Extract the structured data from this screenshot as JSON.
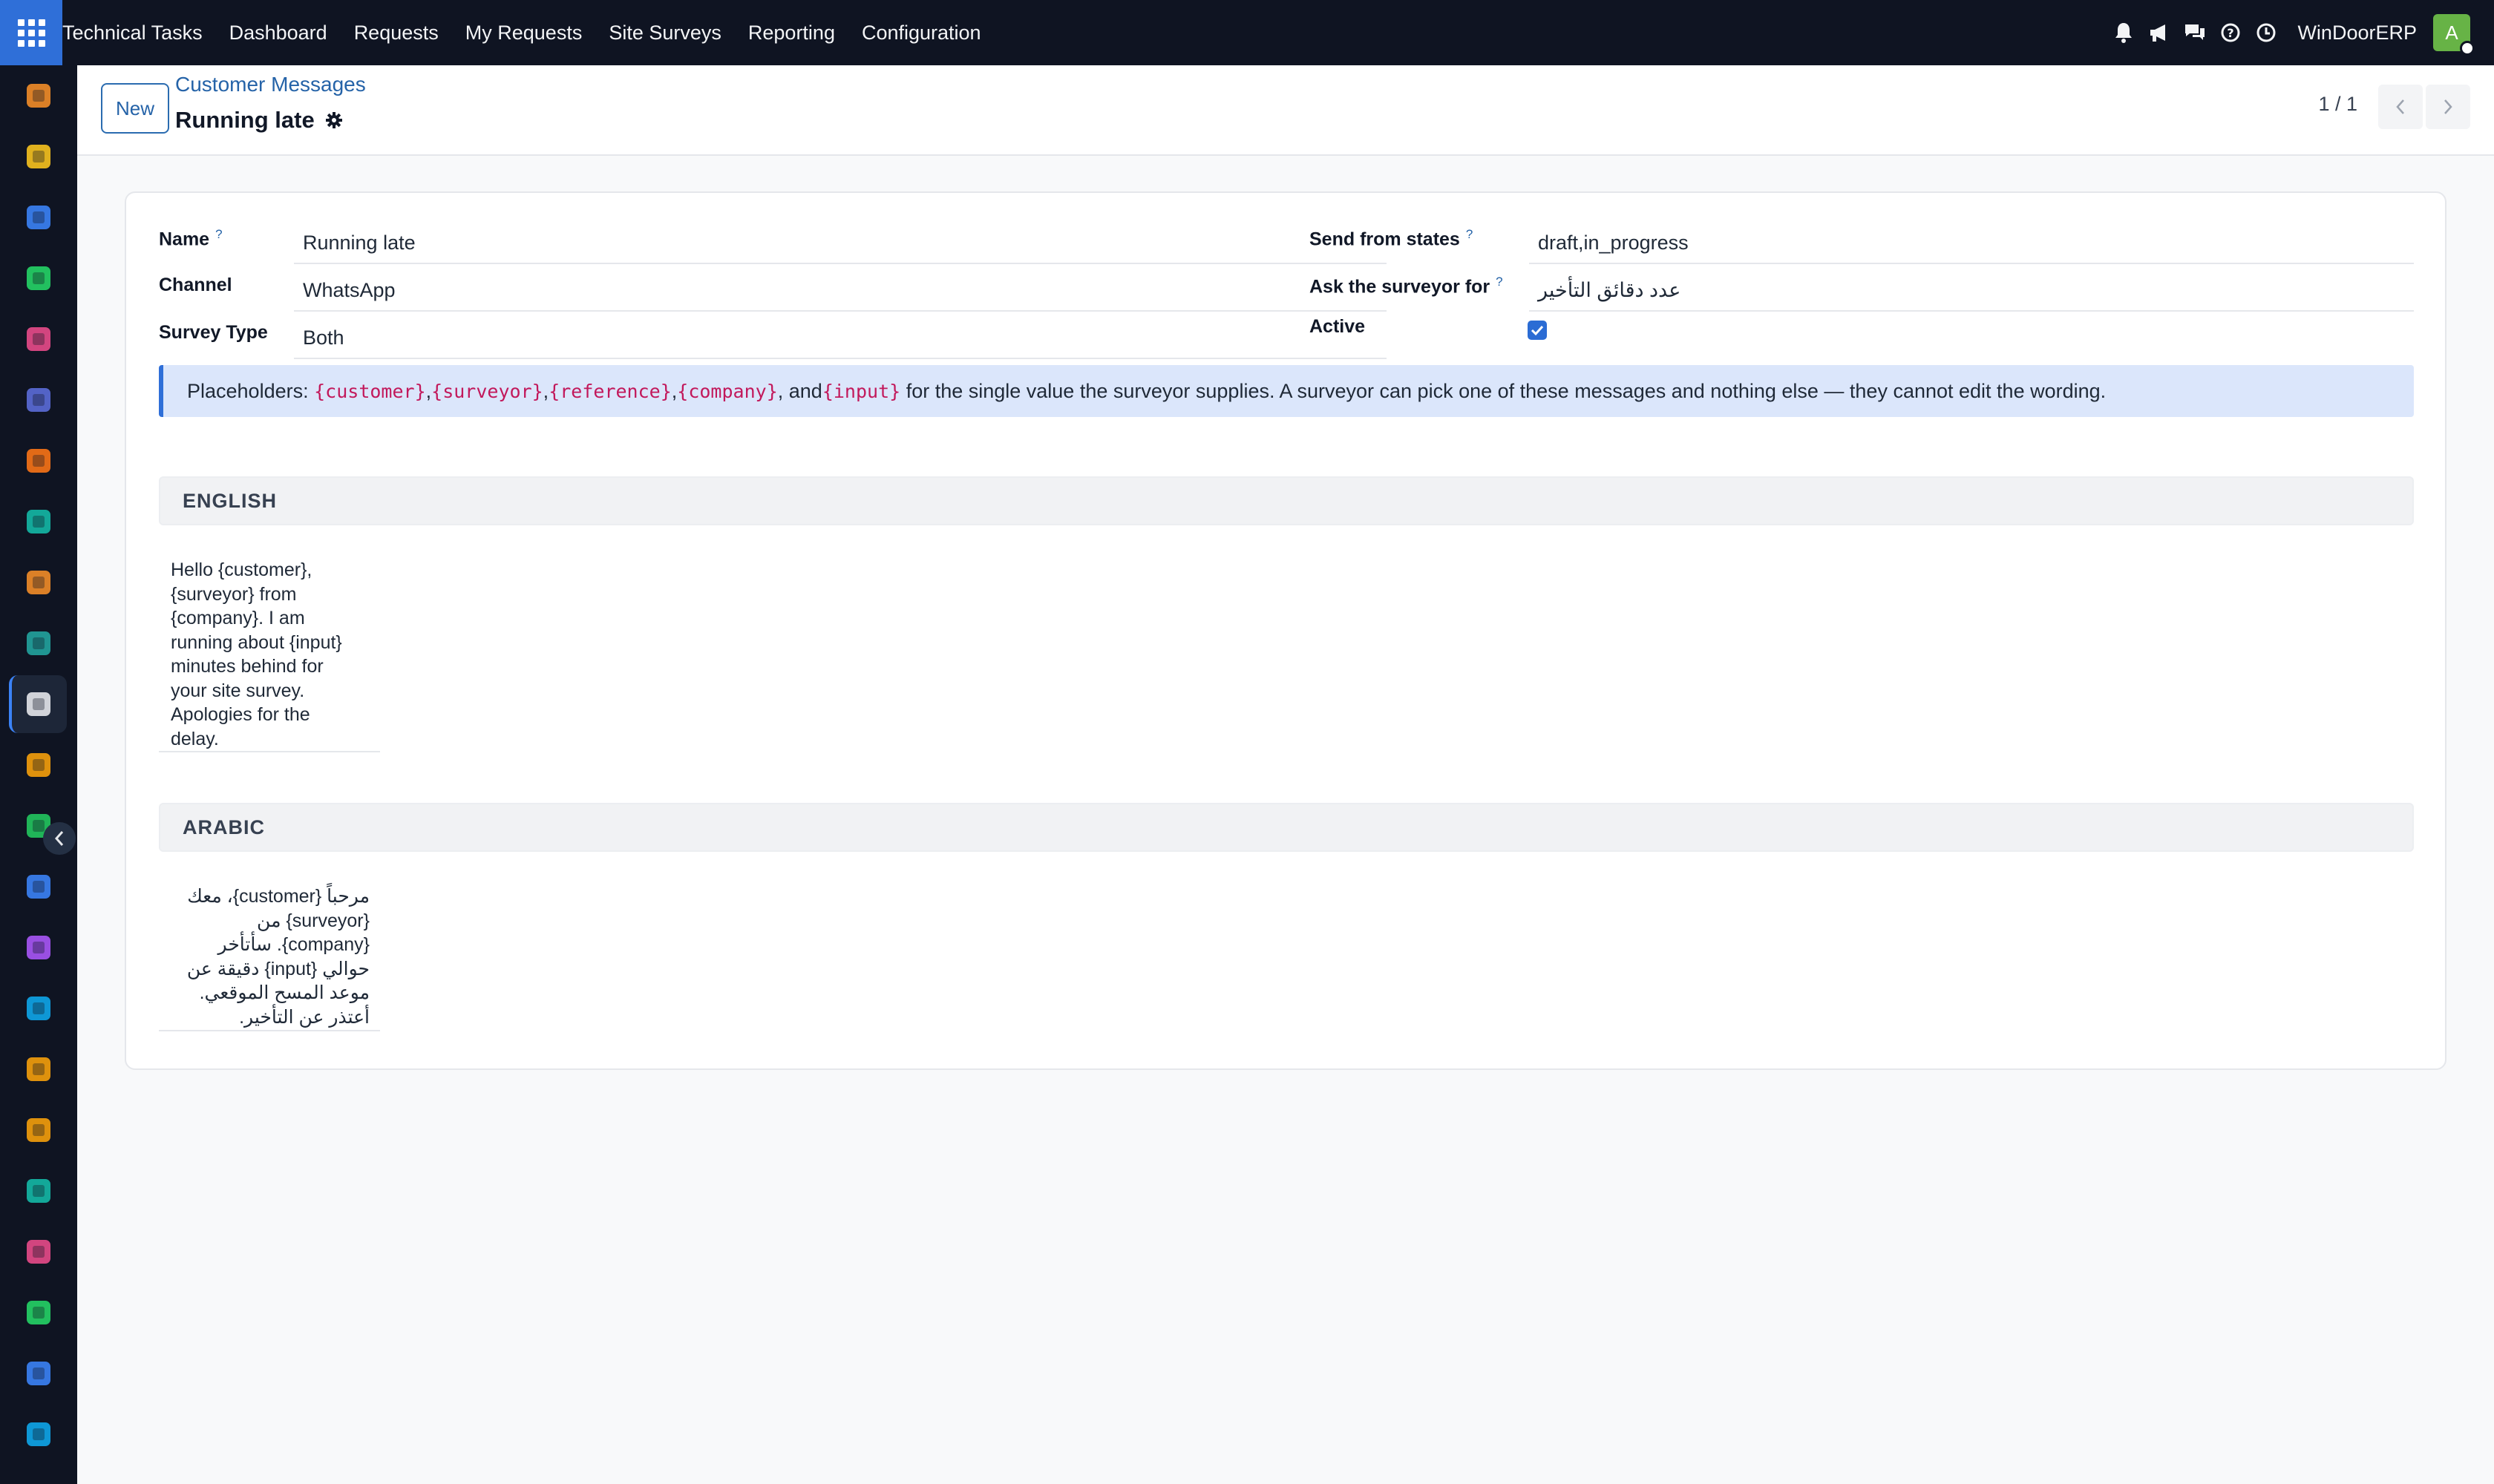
{
  "navbar": {
    "app_name": "Technical Tasks",
    "menu": [
      "Dashboard",
      "Requests",
      "My Requests",
      "Site Surveys",
      "Reporting",
      "Configuration"
    ],
    "right_icons": [
      "bell-icon",
      "megaphone-icon",
      "chat-icon",
      "help-icon",
      "clock-icon"
    ],
    "company": "WinDoorERP",
    "avatar_initial": "A",
    "avatar_color": "#67b346"
  },
  "sidebar": {
    "apps": [
      {
        "icon": "sales-app-icon",
        "color": "#f28c28"
      },
      {
        "icon": "paper-plane-icon",
        "color": "#f7c21e"
      },
      {
        "icon": "clock-app-icon",
        "color": "#3b82f6"
      },
      {
        "icon": "whatsapp-icon",
        "color": "#25d366"
      },
      {
        "icon": "dashboard-app-icon",
        "color": "#e84a8a"
      },
      {
        "icon": "mail-app-icon",
        "color": "#5b6bd8"
      },
      {
        "icon": "chat-bubble-app-icon",
        "color": "#f97316"
      },
      {
        "icon": "check-chevron-app-icon",
        "color": "#14b8a6"
      },
      {
        "icon": "bar-chart-app-icon",
        "color": "#f28c28"
      },
      {
        "icon": "contacts-app-icon",
        "color": "#22a39f"
      },
      {
        "icon": "box-app-icon",
        "color": "#e5e7eb"
      },
      {
        "icon": "tools-app-icon",
        "color": "#f59e0b"
      },
      {
        "icon": "checkmark-app-icon",
        "color": "#22c55e"
      },
      {
        "icon": "book-app-icon",
        "color": "#3b82f6"
      },
      {
        "icon": "package-app-icon",
        "color": "#a855f7"
      },
      {
        "icon": "dollar-app-icon",
        "color": "#0ea5e9"
      },
      {
        "icon": "team-app-icon",
        "color": "#f59e0b"
      },
      {
        "icon": "calendar-app-icon",
        "color": "#f59e0b"
      },
      {
        "icon": "sign-app-icon",
        "color": "#14b8a6"
      },
      {
        "icon": "dashboard-app-icon",
        "color": "#e84a8a"
      },
      {
        "icon": "whatsapp-icon",
        "color": "#25d366"
      },
      {
        "icon": "clock-app-icon",
        "color": "#3b82f6"
      },
      {
        "icon": "discuss-app-icon",
        "color": "#0ea5e9"
      }
    ],
    "active_index": 10
  },
  "control": {
    "new_label": "New",
    "breadcrumb": "Customer Messages",
    "record_title": "Running late",
    "pager": "1 / 1"
  },
  "form": {
    "name_label": "Name",
    "name_value": "Running late",
    "channel_label": "Channel",
    "channel_value": "WhatsApp",
    "survey_type_label": "Survey Type",
    "survey_type_value": "Both",
    "states_label": "Send from states",
    "states_value": "draft,in_progress",
    "ask_label": "Ask the surveyor for",
    "ask_value": "عدد دقائق التأخير",
    "active_label": "Active",
    "active_checked": true,
    "help_mark": "?"
  },
  "alert": {
    "prefix": "Placeholders:",
    "placeholders": [
      "{customer}",
      "{surveyor}",
      "{reference}",
      "{company}",
      "{input}"
    ],
    "sep": ", ",
    "and": ", and ",
    "suffix": "for the single value the surveyor supplies. A surveyor can pick one of these messages and nothing else — they cannot edit the wording."
  },
  "english": {
    "heading": "ENGLISH",
    "lines": [
      "Hello {customer},",
      "{surveyor} from",
      "{company}. I am",
      "running about {input}",
      "minutes behind for",
      "your site survey.",
      "Apologies for the",
      "delay."
    ]
  },
  "arabic": {
    "heading": "ARABIC",
    "lines": [
      "مرحباً {customer}، معك",
      "{surveyor} من",
      "{company}. سأتأخر",
      "حوالي {input} دقيقة عن",
      "موعد المسح الموقعي.",
      "أعتذر عن التأخير."
    ]
  }
}
